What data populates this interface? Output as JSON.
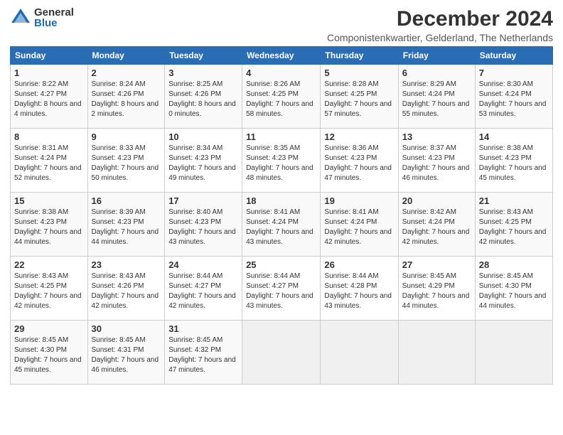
{
  "logo": {
    "general": "General",
    "blue": "Blue"
  },
  "title": "December 2024",
  "subtitle": "Componistenkwartier, Gelderland, The Netherlands",
  "days_header": [
    "Sunday",
    "Monday",
    "Tuesday",
    "Wednesday",
    "Thursday",
    "Friday",
    "Saturday"
  ],
  "weeks": [
    [
      {
        "day": "1",
        "sunrise": "Sunrise: 8:22 AM",
        "sunset": "Sunset: 4:27 PM",
        "daylight": "Daylight: 8 hours and 4 minutes."
      },
      {
        "day": "2",
        "sunrise": "Sunrise: 8:24 AM",
        "sunset": "Sunset: 4:26 PM",
        "daylight": "Daylight: 8 hours and 2 minutes."
      },
      {
        "day": "3",
        "sunrise": "Sunrise: 8:25 AM",
        "sunset": "Sunset: 4:26 PM",
        "daylight": "Daylight: 8 hours and 0 minutes."
      },
      {
        "day": "4",
        "sunrise": "Sunrise: 8:26 AM",
        "sunset": "Sunset: 4:25 PM",
        "daylight": "Daylight: 7 hours and 58 minutes."
      },
      {
        "day": "5",
        "sunrise": "Sunrise: 8:28 AM",
        "sunset": "Sunset: 4:25 PM",
        "daylight": "Daylight: 7 hours and 57 minutes."
      },
      {
        "day": "6",
        "sunrise": "Sunrise: 8:29 AM",
        "sunset": "Sunset: 4:24 PM",
        "daylight": "Daylight: 7 hours and 55 minutes."
      },
      {
        "day": "7",
        "sunrise": "Sunrise: 8:30 AM",
        "sunset": "Sunset: 4:24 PM",
        "daylight": "Daylight: 7 hours and 53 minutes."
      }
    ],
    [
      {
        "day": "8",
        "sunrise": "Sunrise: 8:31 AM",
        "sunset": "Sunset: 4:24 PM",
        "daylight": "Daylight: 7 hours and 52 minutes."
      },
      {
        "day": "9",
        "sunrise": "Sunrise: 8:33 AM",
        "sunset": "Sunset: 4:23 PM",
        "daylight": "Daylight: 7 hours and 50 minutes."
      },
      {
        "day": "10",
        "sunrise": "Sunrise: 8:34 AM",
        "sunset": "Sunset: 4:23 PM",
        "daylight": "Daylight: 7 hours and 49 minutes."
      },
      {
        "day": "11",
        "sunrise": "Sunrise: 8:35 AM",
        "sunset": "Sunset: 4:23 PM",
        "daylight": "Daylight: 7 hours and 48 minutes."
      },
      {
        "day": "12",
        "sunrise": "Sunrise: 8:36 AM",
        "sunset": "Sunset: 4:23 PM",
        "daylight": "Daylight: 7 hours and 47 minutes."
      },
      {
        "day": "13",
        "sunrise": "Sunrise: 8:37 AM",
        "sunset": "Sunset: 4:23 PM",
        "daylight": "Daylight: 7 hours and 46 minutes."
      },
      {
        "day": "14",
        "sunrise": "Sunrise: 8:38 AM",
        "sunset": "Sunset: 4:23 PM",
        "daylight": "Daylight: 7 hours and 45 minutes."
      }
    ],
    [
      {
        "day": "15",
        "sunrise": "Sunrise: 8:38 AM",
        "sunset": "Sunset: 4:23 PM",
        "daylight": "Daylight: 7 hours and 44 minutes."
      },
      {
        "day": "16",
        "sunrise": "Sunrise: 8:39 AM",
        "sunset": "Sunset: 4:23 PM",
        "daylight": "Daylight: 7 hours and 44 minutes."
      },
      {
        "day": "17",
        "sunrise": "Sunrise: 8:40 AM",
        "sunset": "Sunset: 4:23 PM",
        "daylight": "Daylight: 7 hours and 43 minutes."
      },
      {
        "day": "18",
        "sunrise": "Sunrise: 8:41 AM",
        "sunset": "Sunset: 4:24 PM",
        "daylight": "Daylight: 7 hours and 43 minutes."
      },
      {
        "day": "19",
        "sunrise": "Sunrise: 8:41 AM",
        "sunset": "Sunset: 4:24 PM",
        "daylight": "Daylight: 7 hours and 42 minutes."
      },
      {
        "day": "20",
        "sunrise": "Sunrise: 8:42 AM",
        "sunset": "Sunset: 4:24 PM",
        "daylight": "Daylight: 7 hours and 42 minutes."
      },
      {
        "day": "21",
        "sunrise": "Sunrise: 8:43 AM",
        "sunset": "Sunset: 4:25 PM",
        "daylight": "Daylight: 7 hours and 42 minutes."
      }
    ],
    [
      {
        "day": "22",
        "sunrise": "Sunrise: 8:43 AM",
        "sunset": "Sunset: 4:25 PM",
        "daylight": "Daylight: 7 hours and 42 minutes."
      },
      {
        "day": "23",
        "sunrise": "Sunrise: 8:43 AM",
        "sunset": "Sunset: 4:26 PM",
        "daylight": "Daylight: 7 hours and 42 minutes."
      },
      {
        "day": "24",
        "sunrise": "Sunrise: 8:44 AM",
        "sunset": "Sunset: 4:27 PM",
        "daylight": "Daylight: 7 hours and 42 minutes."
      },
      {
        "day": "25",
        "sunrise": "Sunrise: 8:44 AM",
        "sunset": "Sunset: 4:27 PM",
        "daylight": "Daylight: 7 hours and 43 minutes."
      },
      {
        "day": "26",
        "sunrise": "Sunrise: 8:44 AM",
        "sunset": "Sunset: 4:28 PM",
        "daylight": "Daylight: 7 hours and 43 minutes."
      },
      {
        "day": "27",
        "sunrise": "Sunrise: 8:45 AM",
        "sunset": "Sunset: 4:29 PM",
        "daylight": "Daylight: 7 hours and 44 minutes."
      },
      {
        "day": "28",
        "sunrise": "Sunrise: 8:45 AM",
        "sunset": "Sunset: 4:30 PM",
        "daylight": "Daylight: 7 hours and 44 minutes."
      }
    ],
    [
      {
        "day": "29",
        "sunrise": "Sunrise: 8:45 AM",
        "sunset": "Sunset: 4:30 PM",
        "daylight": "Daylight: 7 hours and 45 minutes."
      },
      {
        "day": "30",
        "sunrise": "Sunrise: 8:45 AM",
        "sunset": "Sunset: 4:31 PM",
        "daylight": "Daylight: 7 hours and 46 minutes."
      },
      {
        "day": "31",
        "sunrise": "Sunrise: 8:45 AM",
        "sunset": "Sunset: 4:32 PM",
        "daylight": "Daylight: 7 hours and 47 minutes."
      },
      null,
      null,
      null,
      null
    ]
  ]
}
